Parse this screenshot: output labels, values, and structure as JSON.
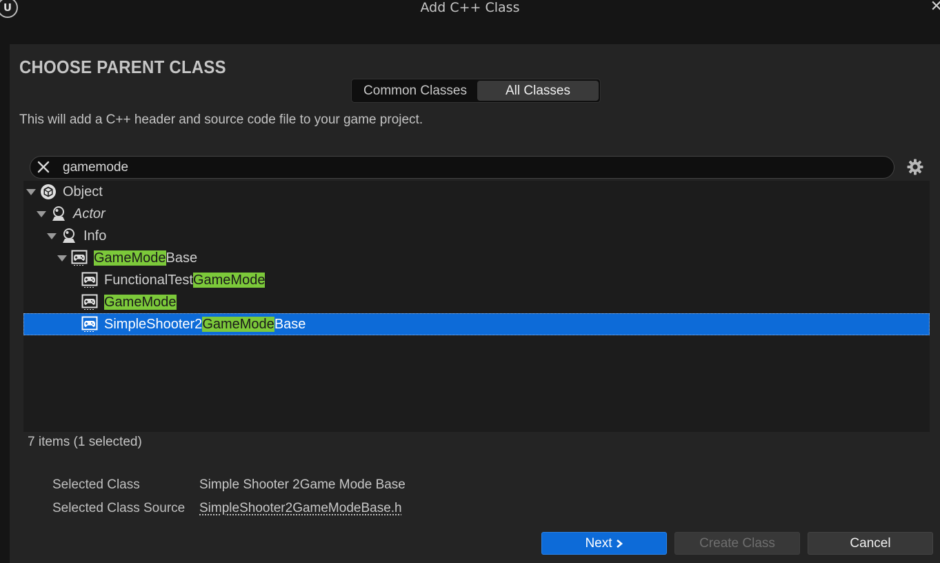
{
  "window": {
    "title": "Add C++ Class",
    "logo_text": "U",
    "close_glyph": "✕"
  },
  "page": {
    "heading": "CHOOSE PARENT CLASS",
    "tabs": [
      {
        "label": "Common Classes",
        "selected": false
      },
      {
        "label": "All Classes",
        "selected": true
      }
    ],
    "description": "This will add a C++ header and source code file to your game project."
  },
  "search": {
    "value": "gamemode"
  },
  "tree": {
    "highlight_color": "#7cc93a",
    "selection_color": "#0d6bd8",
    "items": [
      {
        "pre": "Object",
        "match": "",
        "post": "",
        "icon": "object-cube-icon",
        "expanded": true,
        "italic": false,
        "selected": false
      },
      {
        "pre": "Actor",
        "match": "",
        "post": "",
        "icon": "actor-pawn-icon",
        "expanded": true,
        "italic": true,
        "selected": false
      },
      {
        "pre": "Info",
        "match": "",
        "post": "",
        "icon": "actor-pawn-icon",
        "expanded": true,
        "italic": false,
        "selected": false
      },
      {
        "pre": "",
        "match": "GameMode",
        "post": "Base",
        "icon": "gamepad-icon",
        "expanded": true,
        "italic": false,
        "selected": false
      },
      {
        "pre": "FunctionalTest",
        "match": "GameMode",
        "post": "",
        "icon": "gamepad-icon",
        "expanded": false,
        "italic": false,
        "selected": false
      },
      {
        "pre": "",
        "match": "GameMode",
        "post": "",
        "icon": "gamepad-icon",
        "expanded": false,
        "italic": false,
        "selected": false
      },
      {
        "pre": "SimpleShooter2",
        "match": "GameMode",
        "post": "Base",
        "icon": "gamepad-icon",
        "expanded": false,
        "italic": false,
        "selected": true
      }
    ]
  },
  "status": {
    "count": "7 items (1 selected)"
  },
  "details": {
    "selected_class_label": "Selected Class",
    "selected_class_value": "Simple Shooter 2Game Mode Base",
    "selected_source_label": "Selected Class Source",
    "selected_source_value": "SimpleShooter2GameModeBase.h"
  },
  "buttons": {
    "next": "Next",
    "create": "Create Class",
    "cancel": "Cancel"
  }
}
